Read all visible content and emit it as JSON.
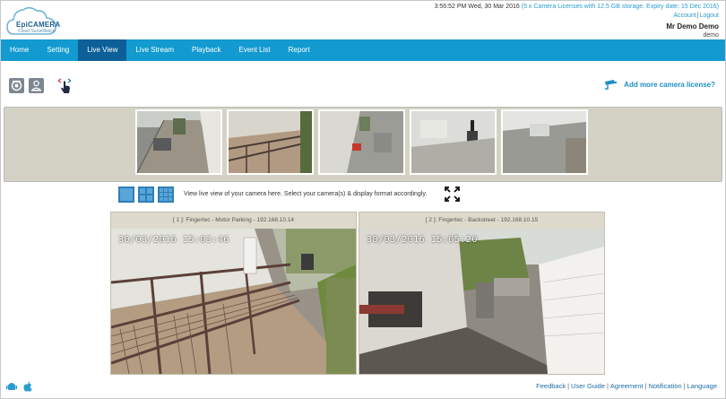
{
  "brand": {
    "name": "EpiCAMERA",
    "tagline": "Cloud Surveillance"
  },
  "header": {
    "time": "3:56:52 PM",
    "date": "Wed, 30 Mar 2016",
    "license": "(5 x Camera Licenses with 12.5 GB storage. Expiry date: 15 Dec 2016)",
    "account_label": "Account",
    "logout_label": "Logout",
    "user_name": "Mr Demo Demo",
    "login": "demo"
  },
  "nav": {
    "items": [
      {
        "label": "Home"
      },
      {
        "label": "Setting"
      },
      {
        "label": "Live View"
      },
      {
        "label": "Live Stream"
      },
      {
        "label": "Playback"
      },
      {
        "label": "Event List"
      },
      {
        "label": "Report"
      }
    ],
    "active": "Live View"
  },
  "toolbar": {
    "icons": [
      "camera-settings-icon",
      "user-camera-icon",
      "touch-select-icon"
    ],
    "add_license_label": "Add more camera license?"
  },
  "thumbnails": [
    "camera-1-thumbnail",
    "camera-2-thumbnail",
    "camera-3-thumbnail",
    "camera-4-thumbnail",
    "camera-5-thumbnail"
  ],
  "layout": {
    "hint": "View live view of your camera here. Select your camera(s) & display format accordingly."
  },
  "cameras": [
    {
      "title": "[ 1 ]: Fingertec - Motor Parking - 192.168.10.14",
      "timestamp": "30/03/2016  15:03:46"
    },
    {
      "title": "[ 2 ]: Fingertec - Backstreet - 192.168.10.15",
      "timestamp": "30/03/2016  15:05:20"
    }
  ],
  "footer": {
    "links": [
      "Feedback",
      "User Guide",
      "Agreement",
      "Notification",
      "Language"
    ]
  },
  "colors": {
    "nav": "#139ad0",
    "nav_active": "#0d5f98",
    "link": "#2a9bd1",
    "strip": "#d3d2c4"
  }
}
